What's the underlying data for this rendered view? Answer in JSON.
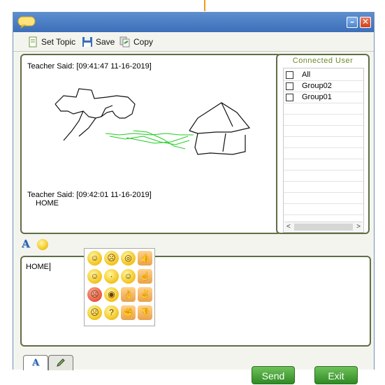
{
  "toolbar": {
    "set_topic": "Set Topic",
    "save": "Save",
    "copy": "Copy"
  },
  "chat": {
    "messages": [
      {
        "header": "Teacher Said: [09:41:47 11-16-2019]",
        "body": ""
      },
      {
        "header": "Teacher Said: [09:42:01 11-16-2019]",
        "body": "HOME"
      }
    ]
  },
  "users": {
    "title": "Connected User",
    "items": [
      {
        "label": "All",
        "checked": false
      },
      {
        "label": "Group02",
        "checked": false
      },
      {
        "label": "Group01",
        "checked": false
      }
    ],
    "scroll_left": "<",
    "scroll_right": ">"
  },
  "input": {
    "value": "HOME"
  },
  "emoji": [
    "grin",
    "cry",
    "dizzy",
    "thumbs-up",
    "smile",
    "kiss",
    "laugh",
    "point-up",
    "angry",
    "shock",
    "ok-hand",
    "victory",
    "sad",
    "think",
    "fist",
    "thumbs-down"
  ],
  "buttons": {
    "send": "Send",
    "exit": "Exit"
  },
  "colors": {
    "title": "#3c6fb8",
    "panel_border": "#5e6e44",
    "button": "#3f9a2e",
    "drawing_green": "#22cc22"
  }
}
